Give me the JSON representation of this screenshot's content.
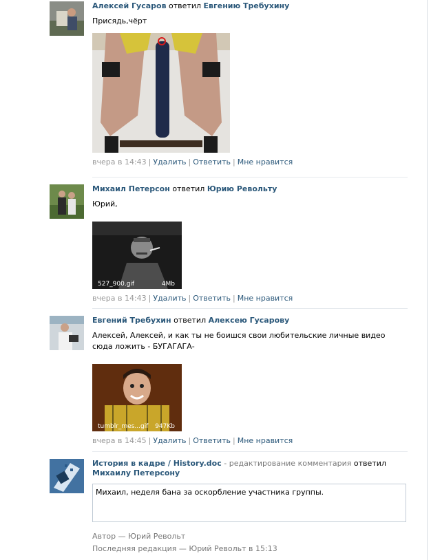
{
  "comments": [
    {
      "author": "Алексей Гусаров",
      "verb": "ответил",
      "target": "Евгению Требухину",
      "text": "Присядь,чёрт",
      "time": "вчера в 14:43",
      "delete": "Удалить",
      "reply": "Ответить",
      "like": "Мне нравится"
    },
    {
      "author": "Михаил Петерсон",
      "verb": "ответил",
      "target": "Юрию Револьту",
      "text": "Юрий,",
      "gif_name": "527_900.gif",
      "gif_size": "4Mb",
      "time": "вчера в 14:43",
      "delete": "Удалить",
      "reply": "Ответить",
      "like": "Мне нравится"
    },
    {
      "author": "Евгений Требухин",
      "verb": "ответил",
      "target": "Алексею Гусарову",
      "text": "Алексей, Алексей, и как ты не боишся свои любительские личные видео сюда ложить - БУГАГАГА-",
      "gif_name": "tumblr_mes...gif",
      "gif_size": "947Kb",
      "time": "вчера в 14:45",
      "delete": "Удалить",
      "reply": "Ответить",
      "like": "Мне нравится"
    },
    {
      "author": "История в кадре / History.doc",
      "note": "- редактирование комментария",
      "verb": "ответил",
      "target": "Михаилу Петерсону",
      "edit_text": "Михаил, неделя бана за оскорбление участника группы.",
      "author_line": "Автор — Юрий Револьт",
      "last_edit": "Последняя редакция — Юрий Револьт в 15:13"
    }
  ],
  "colors": {
    "link": "#2b587a",
    "muted": "#999999",
    "divider": "#e4e8ed",
    "input_border": "#c0cad5"
  }
}
